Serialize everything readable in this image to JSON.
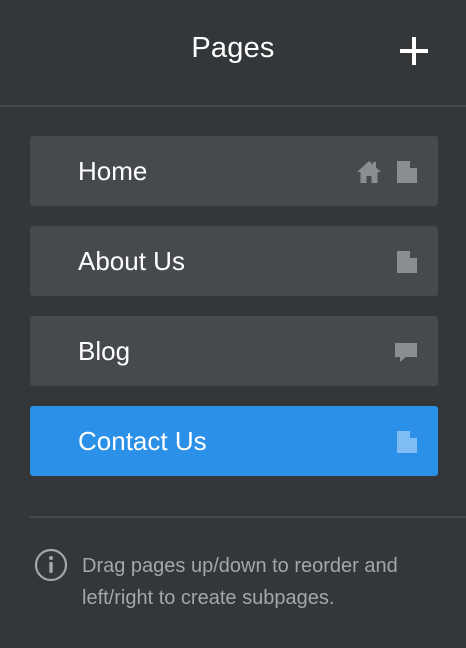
{
  "header": {
    "title": "Pages",
    "add_icon": "plus-icon"
  },
  "pages": [
    {
      "label": "Home",
      "icons": [
        "home-icon",
        "page-icon"
      ],
      "active": false
    },
    {
      "label": "About Us",
      "icons": [
        "page-icon"
      ],
      "active": false
    },
    {
      "label": "Blog",
      "icons": [
        "comment-icon"
      ],
      "active": false
    },
    {
      "label": "Contact Us",
      "icons": [
        "page-icon"
      ],
      "active": true
    }
  ],
  "info": {
    "icon": "info-icon",
    "text": "Drag pages up/down to reorder and left/right to create subpages."
  },
  "colors": {
    "background": "#33373a",
    "item": "#46494d",
    "active": "#2b90e8",
    "icon_muted": "#8a8d91",
    "icon_active": "#7fbcf3",
    "info_text": "#a3a6aa"
  }
}
